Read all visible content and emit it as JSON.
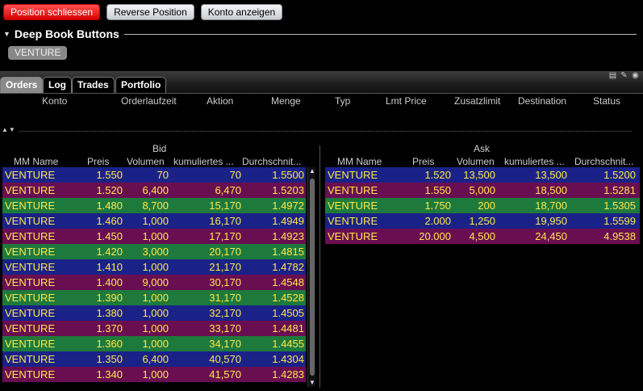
{
  "toolbar": {
    "close_position": "Position schliessen",
    "reverse_position": "Reverse Position",
    "show_account": "Konto anzeigen"
  },
  "deepbook": {
    "title": "Deep Book Buttons",
    "symbol_chip": "VENTURE"
  },
  "tabs": [
    "Orders",
    "Log",
    "Trades",
    "Portfolio"
  ],
  "orders_columns": [
    "Konto",
    "Orderlaufzeit",
    "Aktion",
    "Menge",
    "Typ",
    "Lmt Price",
    "Zusatzlimit",
    "Destination",
    "Status"
  ],
  "bid": {
    "title": "Bid",
    "columns": [
      "MM Name",
      "Preis",
      "Volumen",
      "kumuliertes ...",
      "Durchschnit..."
    ],
    "rows": [
      {
        "name": "VENTURE",
        "price": "1.550",
        "volume": "70",
        "cumulative": "70",
        "average": "1.5500",
        "color": "blue"
      },
      {
        "name": "VENTURE",
        "price": "1.520",
        "volume": "6,400",
        "cumulative": "6,470",
        "average": "1.5203",
        "color": "purple"
      },
      {
        "name": "VENTURE",
        "price": "1.480",
        "volume": "8,700",
        "cumulative": "15,170",
        "average": "1.4972",
        "color": "green"
      },
      {
        "name": "VENTURE",
        "price": "1.460",
        "volume": "1,000",
        "cumulative": "16,170",
        "average": "1.4949",
        "color": "blue"
      },
      {
        "name": "VENTURE",
        "price": "1.450",
        "volume": "1,000",
        "cumulative": "17,170",
        "average": "1.4923",
        "color": "purple"
      },
      {
        "name": "VENTURE",
        "price": "1.420",
        "volume": "3,000",
        "cumulative": "20,170",
        "average": "1.4815",
        "color": "green"
      },
      {
        "name": "VENTURE",
        "price": "1.410",
        "volume": "1,000",
        "cumulative": "21,170",
        "average": "1.4782",
        "color": "blue"
      },
      {
        "name": "VENTURE",
        "price": "1.400",
        "volume": "9,000",
        "cumulative": "30,170",
        "average": "1.4548",
        "color": "purple"
      },
      {
        "name": "VENTURE",
        "price": "1.390",
        "volume": "1,000",
        "cumulative": "31,170",
        "average": "1.4528",
        "color": "green"
      },
      {
        "name": "VENTURE",
        "price": "1.380",
        "volume": "1,000",
        "cumulative": "32,170",
        "average": "1.4505",
        "color": "blue"
      },
      {
        "name": "VENTURE",
        "price": "1.370",
        "volume": "1,000",
        "cumulative": "33,170",
        "average": "1.4481",
        "color": "purple"
      },
      {
        "name": "VENTURE",
        "price": "1.360",
        "volume": "1,000",
        "cumulative": "34,170",
        "average": "1.4455",
        "color": "green"
      },
      {
        "name": "VENTURE",
        "price": "1.350",
        "volume": "6,400",
        "cumulative": "40,570",
        "average": "1.4304",
        "color": "blue"
      },
      {
        "name": "VENTURE",
        "price": "1.340",
        "volume": "1,000",
        "cumulative": "41,570",
        "average": "1.4283",
        "color": "purple"
      }
    ]
  },
  "ask": {
    "title": "Ask",
    "columns": [
      "MM Name",
      "Preis",
      "Volumen",
      "kumuliertes ...",
      "Durchschnit..."
    ],
    "rows": [
      {
        "name": "VENTURE",
        "price": "1.520",
        "volume": "13,500",
        "cumulative": "13,500",
        "average": "1.5200",
        "color": "blue"
      },
      {
        "name": "VENTURE",
        "price": "1.550",
        "volume": "5,000",
        "cumulative": "18,500",
        "average": "1.5281",
        "color": "purple"
      },
      {
        "name": "VENTURE",
        "price": "1.750",
        "volume": "200",
        "cumulative": "18,700",
        "average": "1.5305",
        "color": "green"
      },
      {
        "name": "VENTURE",
        "price": "2.000",
        "volume": "1,250",
        "cumulative": "19,950",
        "average": "1.5599",
        "color": "blue"
      },
      {
        "name": "VENTURE",
        "price": "20.000",
        "volume": "4,500",
        "cumulative": "24,450",
        "average": "4.9538",
        "color": "purple"
      }
    ]
  },
  "colors": {
    "blue": "#1a2288",
    "purple": "#6a0e52",
    "green": "#1e7a3c",
    "text": "#ffe94a",
    "close_button": "#e00000"
  },
  "icons": {
    "tab_icons": [
      "print-icon",
      "wrench-icon",
      "help-icon"
    ],
    "sort": [
      "sort-up-icon",
      "sort-down-icon"
    ],
    "scroll": [
      "scroll-up-icon",
      "scroll-down-icon"
    ]
  }
}
